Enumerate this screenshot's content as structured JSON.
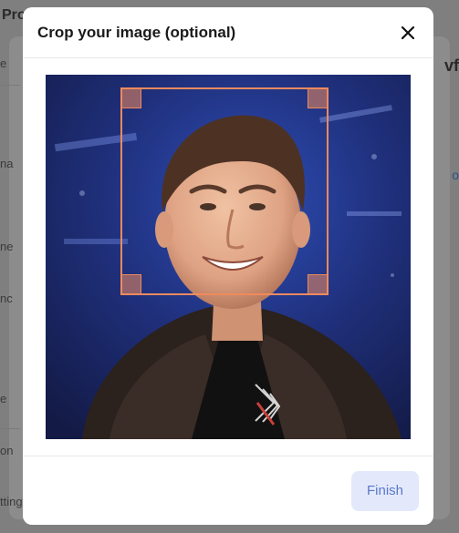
{
  "background": {
    "title": "Pro",
    "side_texts": [
      "e",
      "na",
      "ne",
      "nc",
      "e",
      "on",
      "ttings"
    ],
    "right_heading": "vf",
    "right_link": "o"
  },
  "modal": {
    "title": "Crop your image (optional)",
    "close_icon": "close-icon",
    "finish_label": "Finish"
  },
  "colors": {
    "crop_accent": "#f08a5d",
    "finish_bg": "#e3e9fb",
    "finish_text": "#5b77c9"
  }
}
